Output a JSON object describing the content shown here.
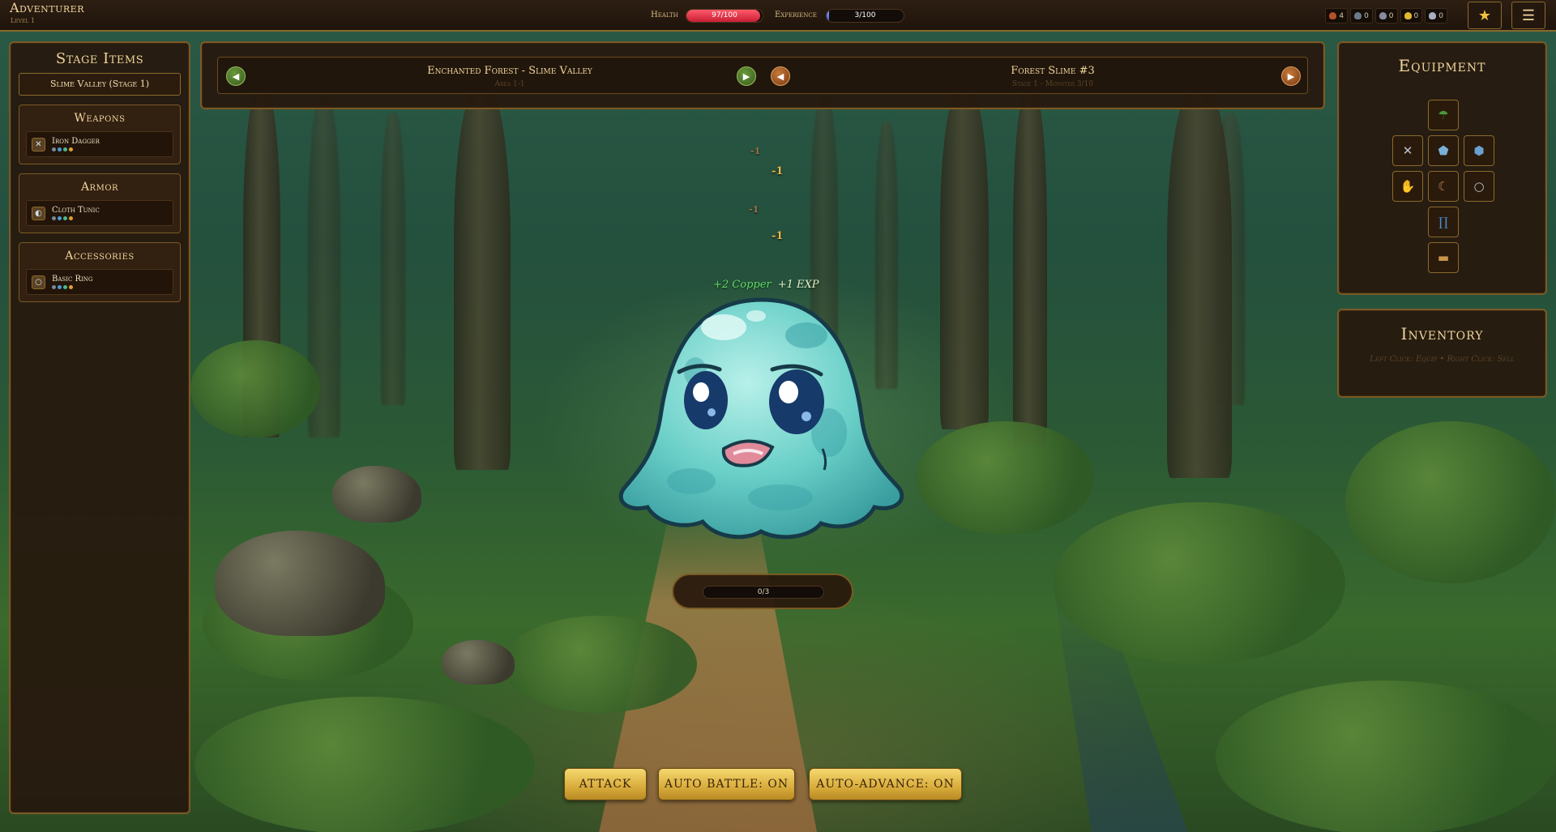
{
  "header": {
    "title": "Adventurer",
    "subtitle": "Level 1",
    "health_label": "Health",
    "health_text": "97/100",
    "health_value": 97,
    "health_max": 100,
    "exp_label": "Experience",
    "exp_text": "3/100",
    "exp_value": 3,
    "exp_max": 100,
    "currencies": [
      {
        "icon": "copper-ore-icon",
        "value": "4",
        "color": "#b4502a"
      },
      {
        "icon": "iron-ore-icon",
        "value": "0",
        "color": "#6a7a8a"
      },
      {
        "icon": "silver-ore-icon",
        "value": "0",
        "color": "#8a8a9a"
      },
      {
        "icon": "gold-coin-icon",
        "value": "0",
        "color": "#e0b830"
      },
      {
        "icon": "platinum-ore-icon",
        "value": "0",
        "color": "#a8b0c0"
      }
    ]
  },
  "left_panel": {
    "title": "Stage Items",
    "stage": "Slime Valley (Stage 1)",
    "categories": [
      {
        "title": "Weapons",
        "item": "Iron Dagger",
        "icon": "dagger-icon"
      },
      {
        "title": "Armor",
        "item": "Cloth Tunic",
        "icon": "shield-icon"
      },
      {
        "title": "Accessories",
        "item": "Basic Ring",
        "icon": "ring-icon"
      }
    ]
  },
  "stage_nav": {
    "area_title": "Enchanted Forest - Slime Valley",
    "area_sub": "Area 1-1",
    "monster_title": "Forest Slime #3",
    "monster_sub": "Stage 1 - Monster 3/10"
  },
  "battle": {
    "damage": [
      "-1",
      "-1",
      "-1",
      "-1"
    ],
    "reward_copper": "+2 Copper",
    "reward_exp": "+1 EXP",
    "progress": "0/3"
  },
  "actions": {
    "attack": "ATTACK",
    "auto_battle": "AUTO BATTLE: ON",
    "auto_advance": "AUTO-ADVANCE: ON"
  },
  "equipment": {
    "title": "Equipment"
  },
  "inventory": {
    "title": "Inventory",
    "hint": "Left Click: Equip • Right Click: Sell"
  },
  "colors": {
    "accent": "#8a6a2c",
    "health": "#e0384a",
    "experience": "#4a7ae0",
    "button": "#e8c25a"
  }
}
